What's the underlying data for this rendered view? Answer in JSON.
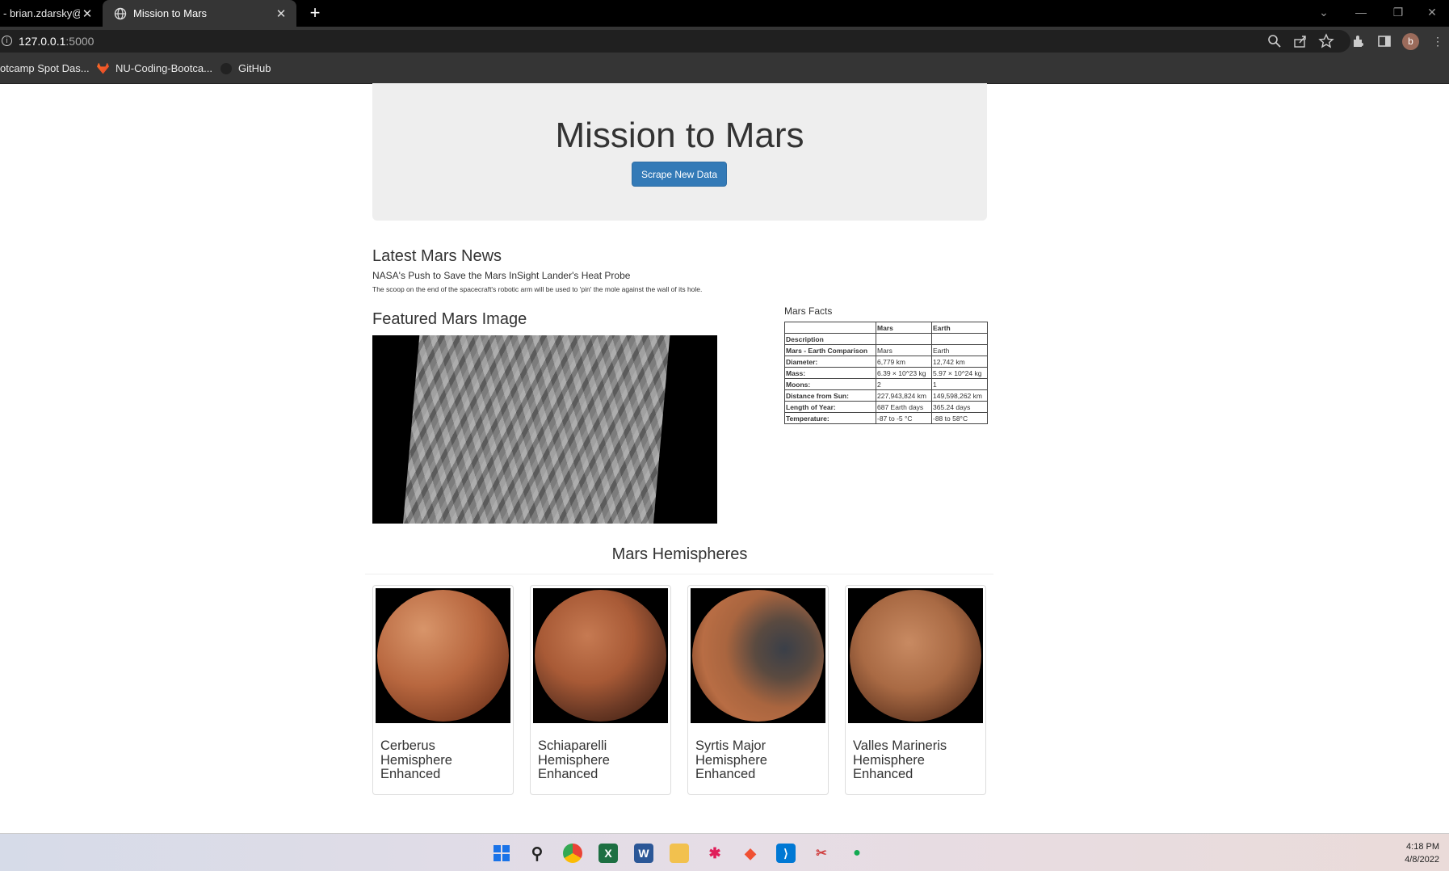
{
  "browser": {
    "tabs": [
      {
        "title": "- brian.zdarsky@g",
        "active": false
      },
      {
        "title": "Mission to Mars",
        "active": true
      }
    ],
    "new_tab_label": "+",
    "url_host": "127.0.0.1",
    "url_port": ":5000",
    "bookmarks": [
      {
        "label": "otcamp Spot Das..."
      },
      {
        "label": "NU-Coding-Bootca..."
      },
      {
        "label": "GitHub"
      }
    ],
    "profile_initial": "b"
  },
  "page": {
    "title": "Mission to Mars",
    "scrape_button": "Scrape New Data",
    "news": {
      "heading": "Latest Mars News",
      "headline": "NASA's Push to Save the Mars InSight Lander's Heat Probe",
      "teaser": "The scoop on the end of the spacecraft's robotic arm will be used to 'pin' the mole against the wall of its hole."
    },
    "featured": {
      "heading": "Featured Mars Image"
    },
    "facts": {
      "heading": "Mars Facts",
      "columns": [
        "",
        "Mars",
        "Earth"
      ],
      "rows": [
        [
          "Description",
          "",
          ""
        ],
        [
          "Mars - Earth Comparison",
          "Mars",
          "Earth"
        ],
        [
          "Diameter:",
          "6,779 km",
          "12,742 km"
        ],
        [
          "Mass:",
          "6.39 × 10^23 kg",
          "5.97 × 10^24 kg"
        ],
        [
          "Moons:",
          "2",
          "1"
        ],
        [
          "Distance from Sun:",
          "227,943,824 km",
          "149,598,262 km"
        ],
        [
          "Length of Year:",
          "687 Earth days",
          "365.24 days"
        ],
        [
          "Temperature:",
          "-87 to -5 °C",
          "-88 to 58°C"
        ]
      ]
    },
    "hemispheres": {
      "heading": "Mars Hemispheres",
      "items": [
        {
          "title": "Cerberus Hemisphere Enhanced"
        },
        {
          "title": "Schiaparelli Hemisphere Enhanced"
        },
        {
          "title": "Syrtis Major Hemisphere Enhanced"
        },
        {
          "title": "Valles Marineris Hemisphere Enhanced"
        }
      ]
    }
  },
  "taskbar": {
    "time": "4:18 PM",
    "date": "4/8/2022"
  }
}
